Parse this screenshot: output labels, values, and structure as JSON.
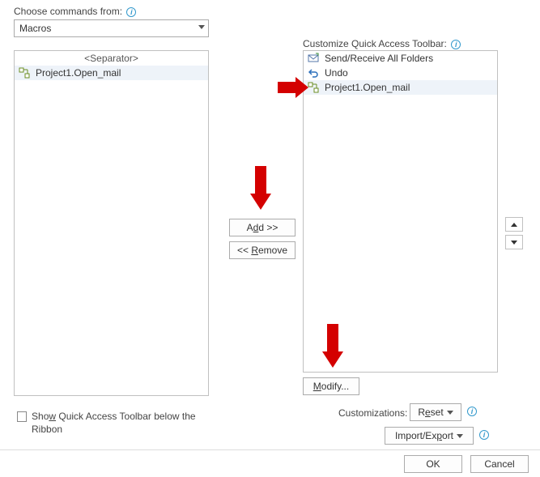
{
  "leftLabel": "Choose commands from:",
  "commandsSelect": "Macros",
  "leftList": {
    "separator": "<Separator>",
    "item1": "Project1.Open_mail"
  },
  "rightLabel": "Customize Quick Access Toolbar:",
  "rightList": {
    "item1": "Send/Receive All Folders",
    "item2": "Undo",
    "item3": "Project1.Open_mail"
  },
  "buttons": {
    "addPrefix": "A",
    "addUnd": "d",
    "addSuffix": "d >>",
    "removePrefix": "<< ",
    "removeUnd": "R",
    "removeSuffix": "emove",
    "modifyUnd": "M",
    "modifySuffix": "odify...",
    "resetPrefix": "R",
    "resetUnd": "e",
    "resetSuffix": "set",
    "importPrefix": "Import/Ex",
    "importUnd": "p",
    "importSuffix": "ort",
    "ok": "OK",
    "cancel": "Cancel"
  },
  "checkboxPrefix": "Sho",
  "checkboxUnd": "w",
  "checkboxSuffix": " Quick Access Toolbar below the Ribbon",
  "customizationsLabel": "Customizations:"
}
